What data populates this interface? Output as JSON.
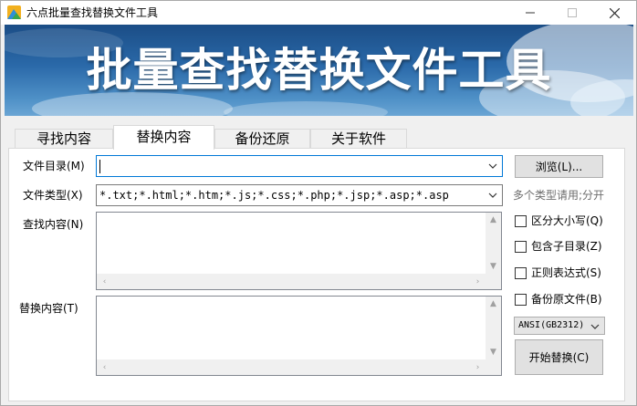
{
  "window": {
    "title": "六点批量查找替换文件工具",
    "minimize_glyph": "—",
    "maximize_glyph": "☐",
    "close_glyph": "✕"
  },
  "banner": {
    "title": "批量查找替换文件工具"
  },
  "tabs": [
    {
      "label": "寻找内容",
      "active": false
    },
    {
      "label": "替换内容",
      "active": true
    },
    {
      "label": "备份还原",
      "active": false
    },
    {
      "label": "关于软件",
      "active": false
    }
  ],
  "form": {
    "dir_label": "文件目录(M)",
    "dir_value": "",
    "type_label": "文件类型(X)",
    "type_value": "*.txt;*.html;*.htm;*.js;*.css;*.php;*.jsp;*.asp;*.asp",
    "find_label": "查找内容(N)",
    "find_value": "",
    "replace_label": "替换内容(T)",
    "replace_value": ""
  },
  "actions": {
    "browse": "浏览(L)...",
    "start_replace": "开始替换(C)"
  },
  "hint": "多个类型请用;分开",
  "options": [
    {
      "label": "区分大小写(Q)",
      "checked": false
    },
    {
      "label": "包含子目录(Z)",
      "checked": false
    },
    {
      "label": "正则表达式(S)",
      "checked": false
    },
    {
      "label": "备份原文件(B)",
      "checked": false
    }
  ],
  "encoding": {
    "selected": "ANSI(GB2312)"
  },
  "colors": {
    "banner_top": "#1b4d86",
    "banner_bottom": "#6aa5d4",
    "focus_border": "#0078d7"
  }
}
